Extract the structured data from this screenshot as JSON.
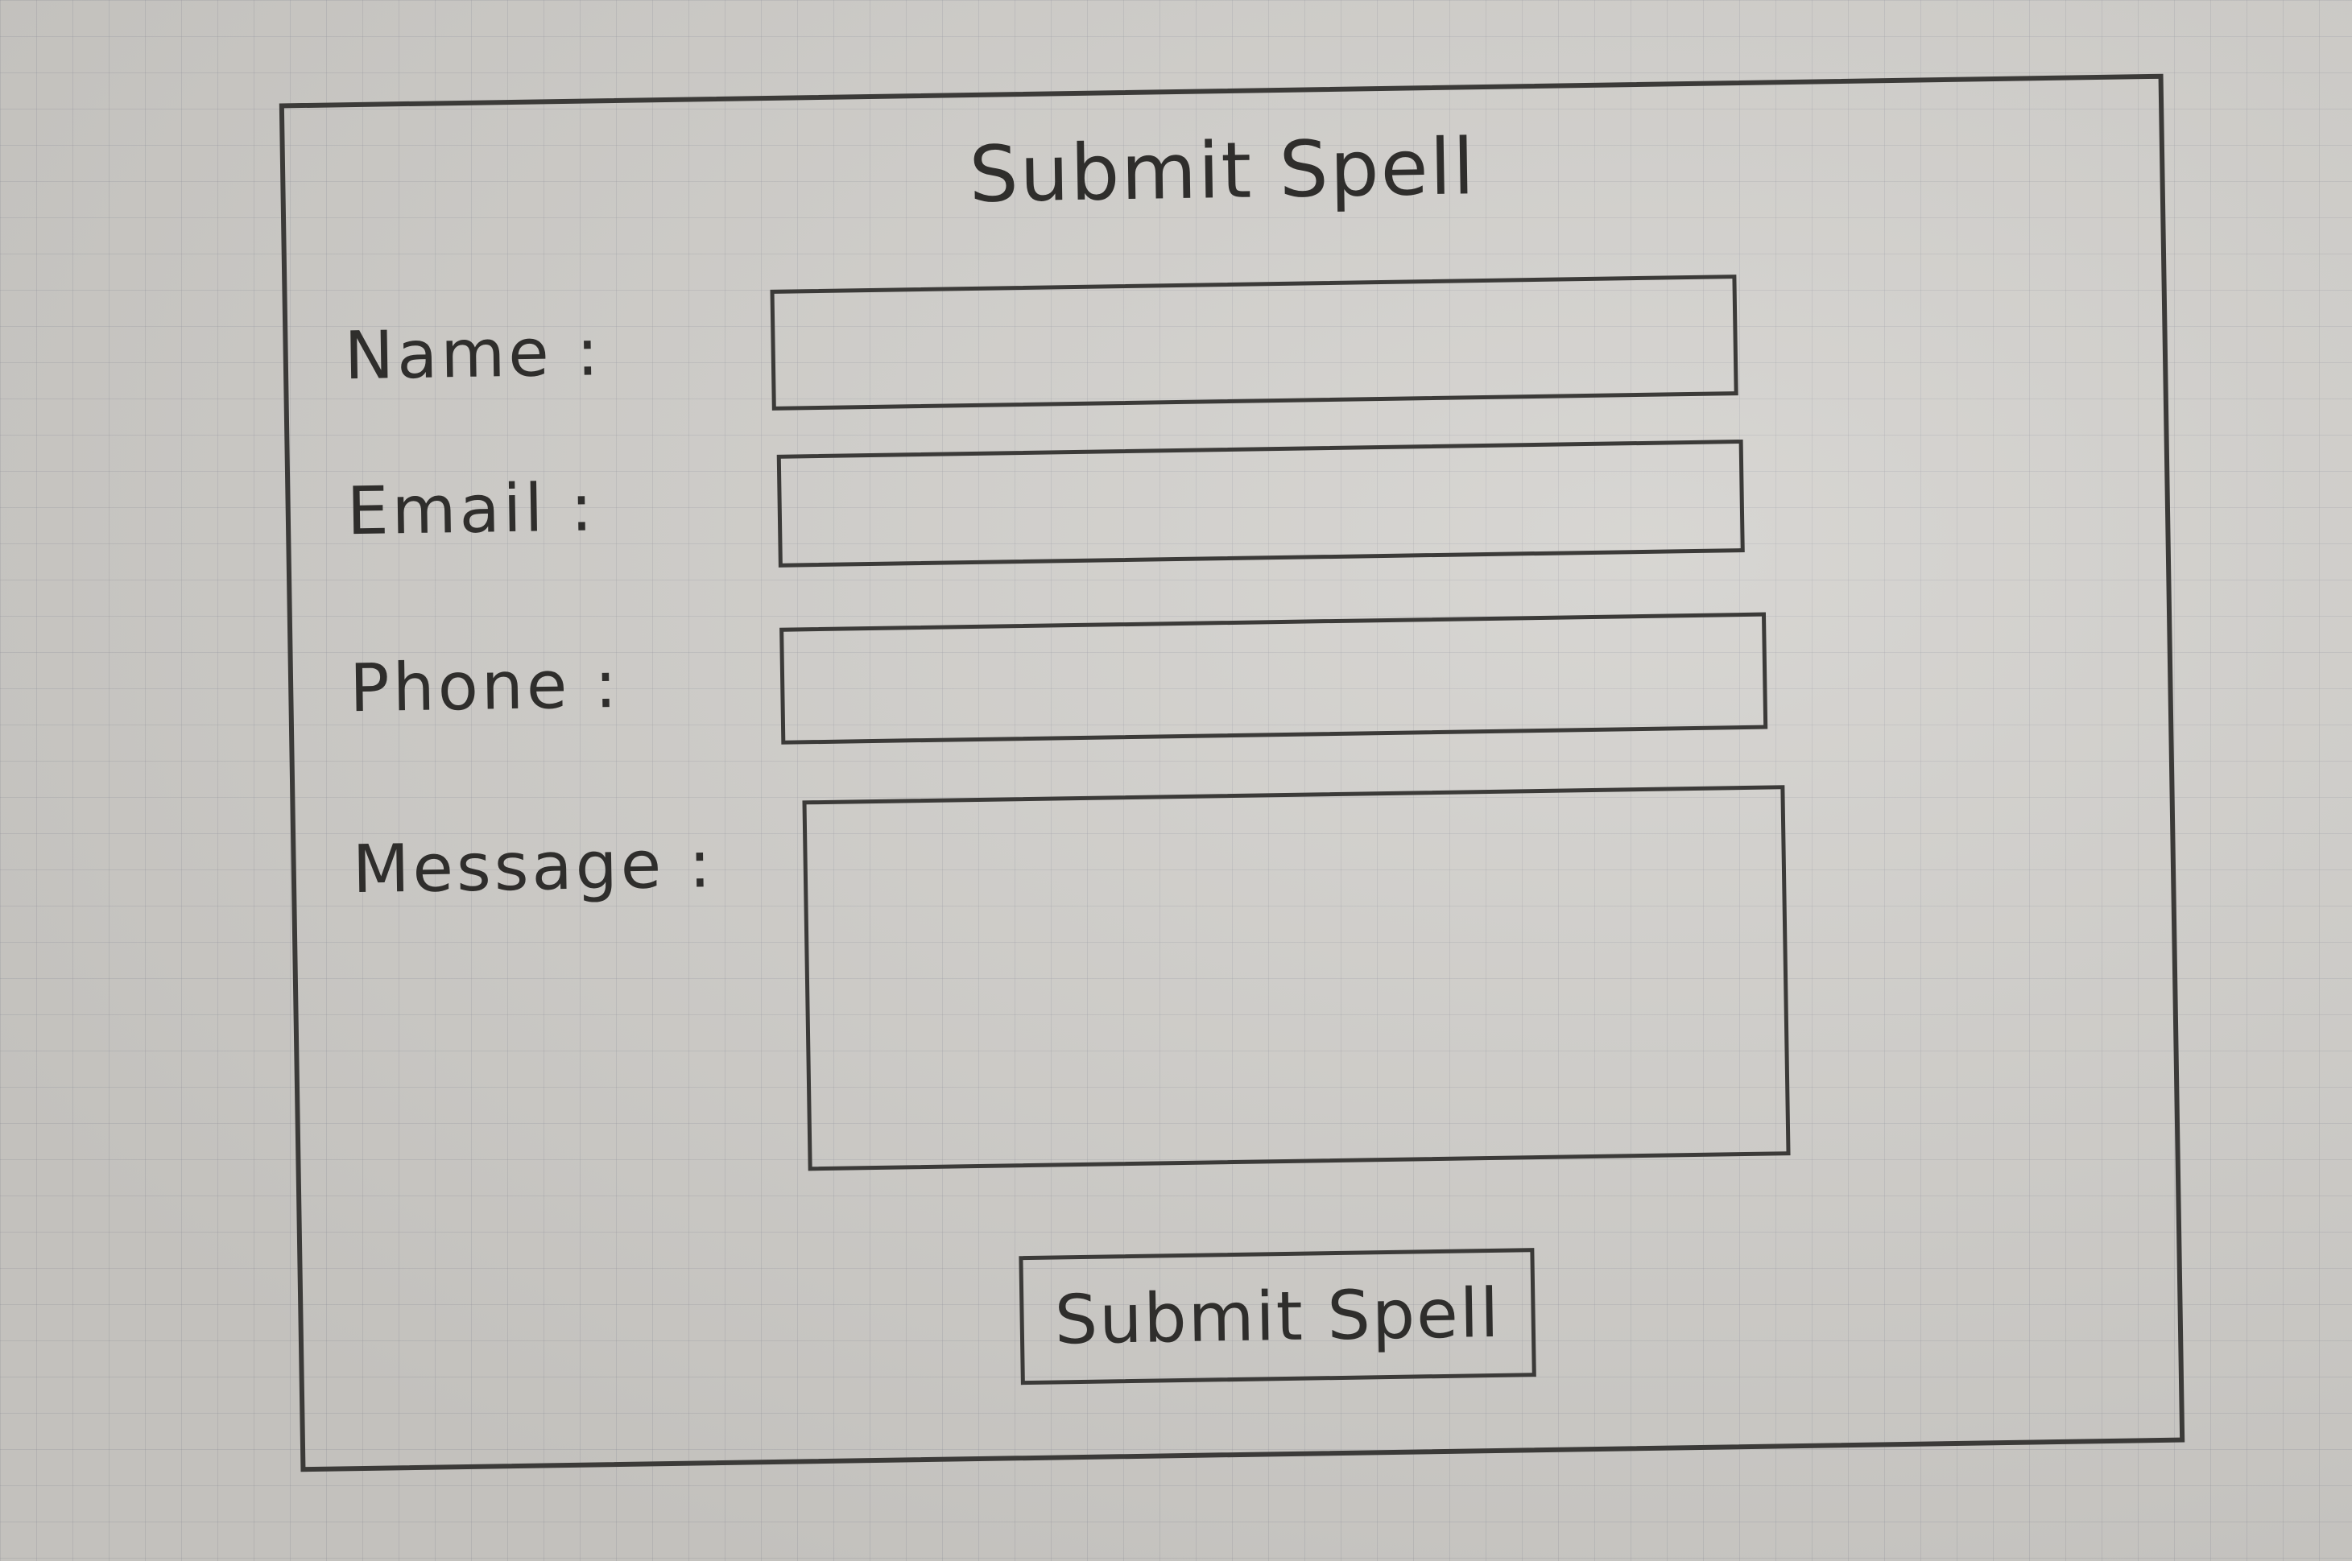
{
  "form": {
    "title": "Submit Spell",
    "fields": {
      "name": {
        "label": "Name :",
        "value": ""
      },
      "email": {
        "label": "Email :",
        "value": ""
      },
      "phone": {
        "label": "Phone :",
        "value": ""
      },
      "message": {
        "label": "Message :",
        "value": ""
      }
    },
    "submit_label": "Submit Spell"
  }
}
